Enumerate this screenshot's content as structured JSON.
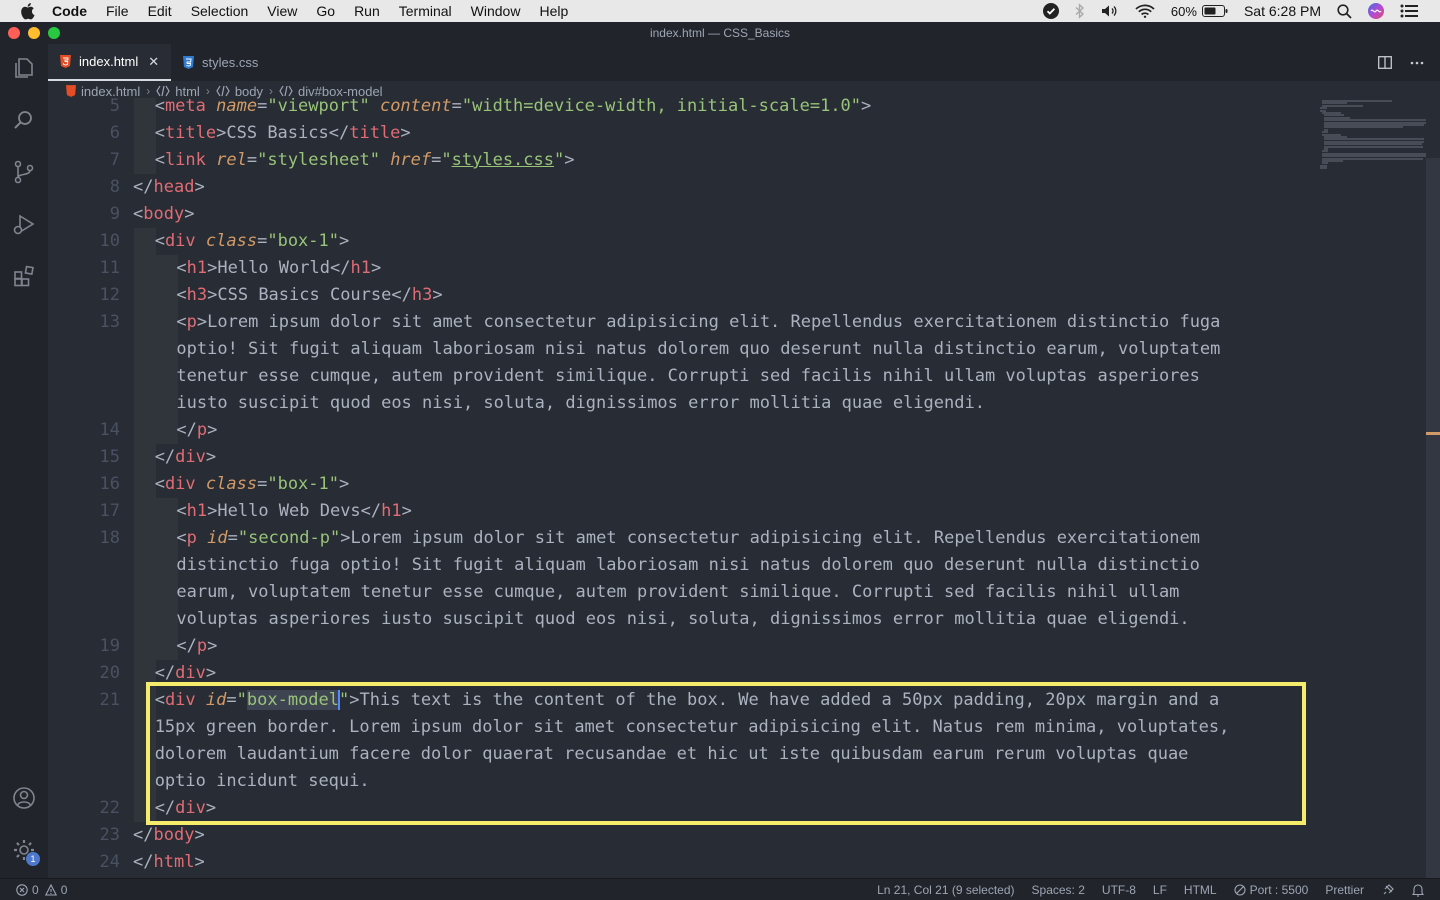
{
  "menubar": {
    "app": "Code",
    "items": [
      "File",
      "Edit",
      "Selection",
      "View",
      "Go",
      "Run",
      "Terminal",
      "Window",
      "Help"
    ],
    "battery": "60%",
    "clock": "Sat 6:28 PM"
  },
  "window": {
    "title": "index.html — CSS_Basics"
  },
  "tabs": [
    {
      "label": "index.html",
      "active": true
    },
    {
      "label": "styles.css",
      "active": false
    }
  ],
  "breadcrumb": [
    "index.html",
    "html",
    "body",
    "div#box-model"
  ],
  "activity": {
    "settings_badge": "1"
  },
  "editor": {
    "line_numbers": [
      "5",
      "6",
      "7",
      "8",
      "9",
      "10",
      "11",
      "12",
      "13",
      "14",
      "15",
      "16",
      "17",
      "18",
      "19",
      "20",
      "21",
      "22",
      "23",
      "24"
    ],
    "lines": [
      {
        "n": 0,
        "tokens": [
          [
            "p",
            "<"
          ],
          [
            "t",
            "meta"
          ],
          [
            "x",
            " "
          ],
          [
            "a",
            "name"
          ],
          [
            "p",
            "="
          ],
          [
            "s",
            "\"viewport\""
          ],
          [
            "x",
            " "
          ],
          [
            "a",
            "content"
          ],
          [
            "p",
            "="
          ],
          [
            "s",
            "\"width=device-width, initial-scale=1.0\""
          ],
          [
            "p",
            ">"
          ]
        ]
      },
      {
        "n": 1,
        "tokens": [
          [
            "p",
            "<"
          ],
          [
            "t",
            "title"
          ],
          [
            "p",
            ">"
          ],
          [
            "x",
            "CSS Basics"
          ],
          [
            "p",
            "</"
          ],
          [
            "t",
            "title"
          ],
          [
            "p",
            ">"
          ]
        ]
      },
      {
        "n": 2,
        "tokens": [
          [
            "p",
            "<"
          ],
          [
            "t",
            "link"
          ],
          [
            "x",
            " "
          ],
          [
            "a",
            "rel"
          ],
          [
            "p",
            "="
          ],
          [
            "s",
            "\"stylesheet\""
          ],
          [
            "x",
            " "
          ],
          [
            "a",
            "href"
          ],
          [
            "p",
            "="
          ],
          [
            "s",
            "\""
          ],
          [
            "su",
            "styles.css"
          ],
          [
            "s",
            "\""
          ],
          [
            "p",
            ">"
          ]
        ]
      },
      {
        "n": 3,
        "tokens": [
          [
            "p",
            "</"
          ],
          [
            "t",
            "head"
          ],
          [
            "p",
            ">"
          ]
        ]
      },
      {
        "n": 4,
        "tokens": [
          [
            "p",
            "<"
          ],
          [
            "t",
            "body"
          ],
          [
            "p",
            ">"
          ]
        ]
      },
      {
        "n": 5,
        "tokens": [
          [
            "p",
            "<"
          ],
          [
            "t",
            "div"
          ],
          [
            "x",
            " "
          ],
          [
            "a",
            "class"
          ],
          [
            "p",
            "="
          ],
          [
            "s",
            "\"box-1\""
          ],
          [
            "p",
            ">"
          ]
        ]
      },
      {
        "n": 6,
        "tokens": [
          [
            "p",
            "<"
          ],
          [
            "t",
            "h1"
          ],
          [
            "p",
            ">"
          ],
          [
            "x",
            "Hello World"
          ],
          [
            "p",
            "</"
          ],
          [
            "t",
            "h1"
          ],
          [
            "p",
            ">"
          ]
        ]
      },
      {
        "n": 7,
        "tokens": [
          [
            "p",
            "<"
          ],
          [
            "t",
            "h3"
          ],
          [
            "p",
            ">"
          ],
          [
            "x",
            "CSS Basics Course"
          ],
          [
            "p",
            "</"
          ],
          [
            "t",
            "h3"
          ],
          [
            "p",
            ">"
          ]
        ]
      },
      {
        "n": 8,
        "tokens": [
          [
            "p",
            "<"
          ],
          [
            "t",
            "p"
          ],
          [
            "p",
            ">"
          ],
          [
            "x",
            "Lorem ipsum dolor sit amet consectetur adipisicing elit. Repellendus exercitationem distinctio fuga"
          ]
        ]
      },
      {
        "n": 9,
        "tokens": [
          [
            "x",
            "optio! Sit fugit aliquam laboriosam nisi natus dolorem quo deserunt nulla distinctio earum, voluptatem"
          ]
        ]
      },
      {
        "n": 10,
        "tokens": [
          [
            "x",
            "tenetur esse cumque, autem provident similique. Corrupti sed facilis nihil ullam voluptas asperiores"
          ]
        ]
      },
      {
        "n": 11,
        "tokens": [
          [
            "x",
            "iusto suscipit quod eos nisi, soluta, dignissimos error mollitia quae eligendi."
          ]
        ]
      },
      {
        "n": 12,
        "tokens": [
          [
            "p",
            "</"
          ],
          [
            "t",
            "p"
          ],
          [
            "p",
            ">"
          ]
        ]
      },
      {
        "n": 13,
        "tokens": [
          [
            "p",
            "</"
          ],
          [
            "t",
            "div"
          ],
          [
            "p",
            ">"
          ]
        ]
      },
      {
        "n": 14,
        "tokens": [
          [
            "p",
            "<"
          ],
          [
            "t",
            "div"
          ],
          [
            "x",
            " "
          ],
          [
            "a",
            "class"
          ],
          [
            "p",
            "="
          ],
          [
            "s",
            "\"box-1\""
          ],
          [
            "p",
            ">"
          ]
        ]
      },
      {
        "n": 15,
        "tokens": [
          [
            "p",
            "<"
          ],
          [
            "t",
            "h1"
          ],
          [
            "p",
            ">"
          ],
          [
            "x",
            "Hello Web Devs"
          ],
          [
            "p",
            "</"
          ],
          [
            "t",
            "h1"
          ],
          [
            "p",
            ">"
          ]
        ]
      },
      {
        "n": 16,
        "tokens": [
          [
            "p",
            "<"
          ],
          [
            "t",
            "p"
          ],
          [
            "x",
            " "
          ],
          [
            "a",
            "id"
          ],
          [
            "p",
            "="
          ],
          [
            "s",
            "\"second-p\""
          ],
          [
            "p",
            ">"
          ],
          [
            "x",
            "Lorem ipsum dolor sit amet consectetur adipisicing elit. Repellendus exercitationem"
          ]
        ]
      },
      {
        "n": 17,
        "tokens": [
          [
            "x",
            "distinctio fuga optio! Sit fugit aliquam laboriosam nisi natus dolorem quo deserunt nulla distinctio"
          ]
        ]
      },
      {
        "n": 18,
        "tokens": [
          [
            "x",
            "earum, voluptatem tenetur esse cumque, autem provident similique. Corrupti sed facilis nihil ullam"
          ]
        ]
      },
      {
        "n": 19,
        "tokens": [
          [
            "x",
            "voluptas asperiores iusto suscipit quod eos nisi, soluta, dignissimos error mollitia quae eligendi."
          ]
        ]
      },
      {
        "n": 20,
        "tokens": [
          [
            "p",
            "</"
          ],
          [
            "t",
            "p"
          ],
          [
            "p",
            ">"
          ]
        ]
      },
      {
        "n": 21,
        "tokens": [
          [
            "p",
            "</"
          ],
          [
            "t",
            "div"
          ],
          [
            "p",
            ">"
          ]
        ]
      },
      {
        "n": 22,
        "tokens": [
          [
            "p",
            "<"
          ],
          [
            "t",
            "div"
          ],
          [
            "x",
            " "
          ],
          [
            "a",
            "id"
          ],
          [
            "p",
            "="
          ],
          [
            "s",
            "\""
          ],
          [
            "ss",
            "box-model"
          ],
          [
            "cur",
            ""
          ],
          [
            "s",
            "\""
          ],
          [
            "p",
            ">"
          ],
          [
            "x",
            "This text is the content of the box. We have added a 50px padding, 20px margin and a"
          ]
        ]
      },
      {
        "n": 23,
        "tokens": [
          [
            "x",
            "15px green border. Lorem ipsum dolor sit amet consectetur adipisicing elit. Natus rem minima, voluptates,"
          ]
        ]
      },
      {
        "n": 24,
        "tokens": [
          [
            "x",
            "dolorem laudantium facere dolor quaerat recusandae et hic ut iste quibusdam earum rerum voluptas quae"
          ]
        ]
      },
      {
        "n": 25,
        "tokens": [
          [
            "x",
            "optio incidunt sequi."
          ]
        ]
      },
      {
        "n": 26,
        "tokens": [
          [
            "p",
            "</"
          ],
          [
            "t",
            "div"
          ],
          [
            "p",
            ">"
          ]
        ]
      },
      {
        "n": 27,
        "tokens": [
          [
            "p",
            "</"
          ],
          [
            "t",
            "body"
          ],
          [
            "p",
            ">"
          ]
        ]
      },
      {
        "n": 28,
        "tokens": [
          [
            "p",
            "</"
          ],
          [
            "t",
            "html"
          ],
          [
            "p",
            ">"
          ]
        ]
      }
    ]
  },
  "status": {
    "errors": "0",
    "warnings": "0",
    "position": "Ln 21, Col 21 (9 selected)",
    "spaces": "Spaces: 2",
    "encoding": "UTF-8",
    "eol": "LF",
    "language": "HTML",
    "port": "Port : 5500",
    "formatter": "Prettier"
  },
  "colors": {
    "highlight_box": "#f6ec6c",
    "tag": "#e06c75",
    "attr": "#d19a66",
    "string": "#98c379"
  }
}
